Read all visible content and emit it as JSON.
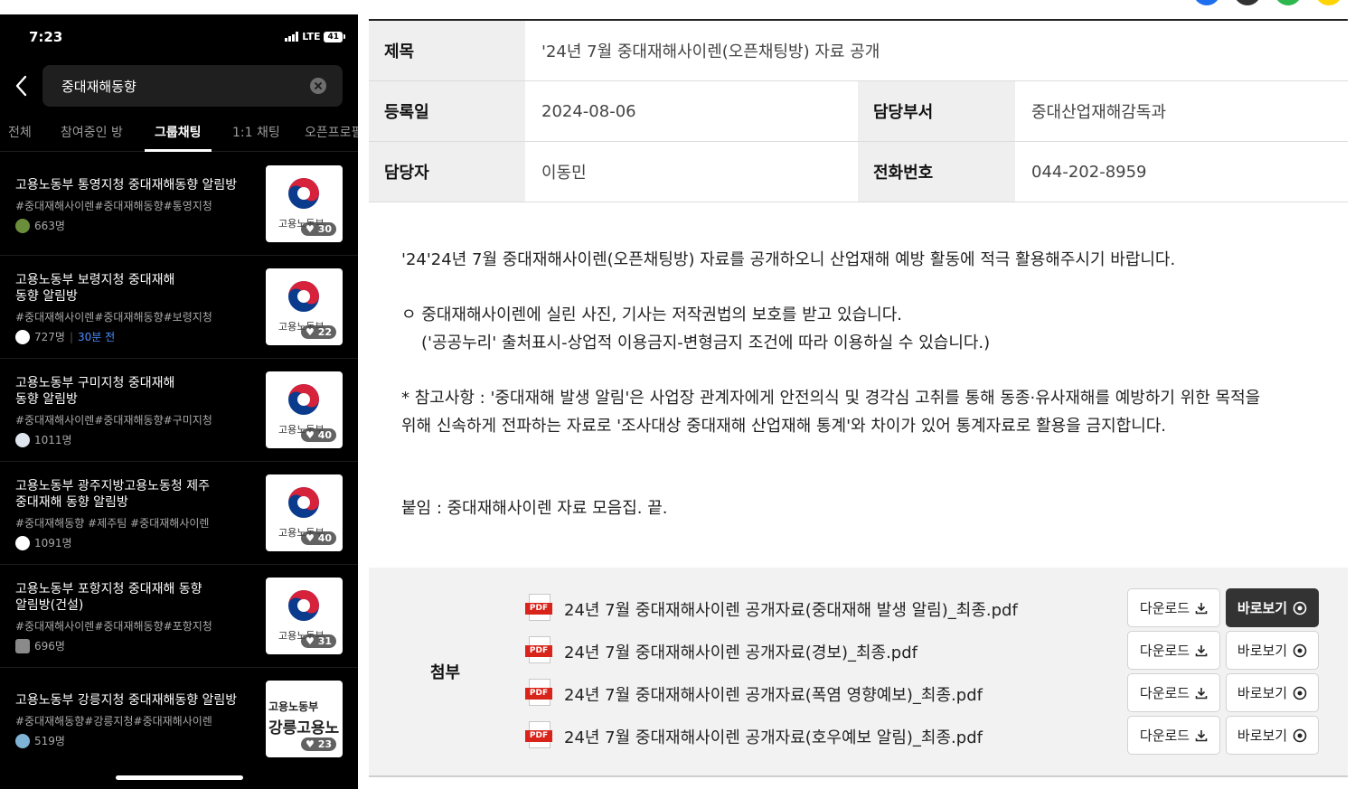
{
  "status_bar": {
    "time": "7:23",
    "network": "LTE",
    "battery": "41"
  },
  "search": {
    "query": "중대재해동향"
  },
  "tabs": [
    {
      "label": "전체"
    },
    {
      "label": "참여중인 방"
    },
    {
      "label": "그룹채팅"
    },
    {
      "label": "1:1 채팅"
    },
    {
      "label": "오픈프로필"
    }
  ],
  "active_tab": "그룹채팅",
  "rooms": [
    {
      "name": "고용노동부 통영지청 중대재해동향 알림방",
      "tags": "#중대재해사이렌#중대재해동향#통영지청",
      "members": "663명",
      "recent": "",
      "likes": "30",
      "thumb_label": "고용노동부"
    },
    {
      "name": "고용노동부 보령지청 중대재해\n동향 알림방",
      "tags": "#중대재해사이렌#중대재해동향#보령지청",
      "members": "727명",
      "recent": "30분 전",
      "likes": "22",
      "thumb_label": "고용노동부"
    },
    {
      "name": "고용노동부 구미지청 중대재해\n동향 알림방",
      "tags": "#중대재해사이렌#중대재해동향#구미지청",
      "members": "1011명",
      "recent": "",
      "likes": "40",
      "thumb_label": "고용노동부"
    },
    {
      "name": "고용노동부 광주지방고용노동청 제주\n중대재해 동향 알림방",
      "tags": "#중대재해동향 #제주팀 #중대재해사이렌",
      "members": "1091명",
      "recent": "",
      "likes": "40",
      "thumb_label": "고용노동부"
    },
    {
      "name": "고용노동부 포항지청 중대재해 동향\n알림방(건설)",
      "tags": "#중대재해사이렌#중대재해동향#포항지청",
      "members": "696명",
      "recent": "",
      "likes": "31",
      "thumb_label": "고용노동부"
    },
    {
      "name": "고용노동부 강릉지청 중대재해동향 알림방",
      "tags": "#중대재해동향#강릉지청#중대재해사이렌",
      "members": "519명",
      "recent": "",
      "likes": "23",
      "thumb_label": "고용노동부",
      "thumb_label2": "강릉고용노"
    }
  ],
  "doc": {
    "title_label": "제목",
    "title": "'24년 7월 중대재해사이렌(오픈채팅방) 자료 공개",
    "date_label": "등록일",
    "date": "2024-08-06",
    "dept_label": "담당부서",
    "dept": "중대산업재해감독과",
    "person_label": "담당자",
    "person": "이동민",
    "phone_label": "전화번호",
    "phone": "044-202-8959",
    "para1": "'24'24년 7월 중대재해사이렌(오픈채팅방) 자료를 공개하오니 산업재해 예방 활동에 적극 활용해주시기 바랍니다.",
    "para2a": "ㅇ 중대재해사이렌에 실린 사진, 기사는 저작권법의 보호를 받고 있습니다.",
    "para2b": "('공공누리' 출처표시-상업적 이용금지-변형금지 조건에 따라 이용하실 수 있습니다.)",
    "para3a": "* 참고사항 : '중대재해 발생 알림'은 사업장 관계자에게 안전의식 및 경각심 고취를 통해 동종·유사재해를 예방하기 위한 목적을",
    "para3b": "위해 신속하게 전파하는 자료로 '조사대상 중대재해 산업재해 통계'와 차이가 있어 통계자료로 활용을 금지합니다.",
    "para4": "붙임 : 중대재해사이렌 자료 모음집. 끝.",
    "attach_label": "첨부",
    "download_label": "다운로드",
    "view_label": "바로보기",
    "pdf_tag": "PDF",
    "files": [
      {
        "name": "24년 7월 중대재해사이렌 공개자료(중대재해 발생 알림)_최종.pdf"
      },
      {
        "name": "24년 7월 중대재해사이렌 공개자료(경보)_최종.pdf"
      },
      {
        "name": "24년 7월 중대재해사이렌 공개자료(폭염 영향예보)_최종.pdf"
      },
      {
        "name": "24년 7월 중대재해사이렌 공개자료(호우예보 알림)_최종.pdf"
      }
    ]
  },
  "colors": {
    "accent_blue": "#4c8dff",
    "pdf_red": "#d9241b",
    "view_button_active": "#333333",
    "dot_colors": [
      "#1e6ff0",
      "#333333",
      "#2db84d",
      "#ffd400"
    ]
  },
  "icons": [
    "back-chevron-icon",
    "clear-icon",
    "gov-emblem-icon",
    "heart-icon",
    "pdf-icon",
    "download-icon",
    "eye-icon"
  ]
}
